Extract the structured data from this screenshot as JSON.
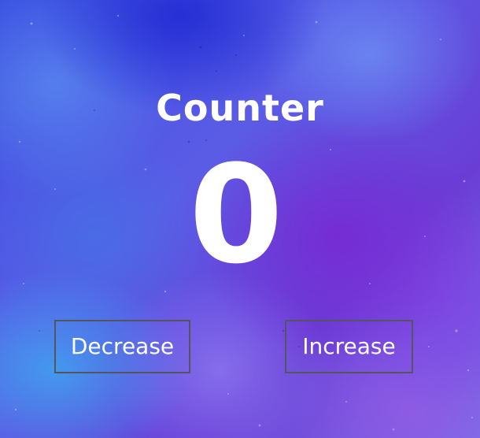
{
  "counter": {
    "title": "Counter",
    "value": "0"
  },
  "buttons": {
    "decrease_label": "Decrease",
    "increase_label": "Increase"
  },
  "colors": {
    "text": "#ffffff",
    "button_border": "#555560",
    "background_blue": "#3a4fe0",
    "background_purple": "#6a3ed6"
  }
}
